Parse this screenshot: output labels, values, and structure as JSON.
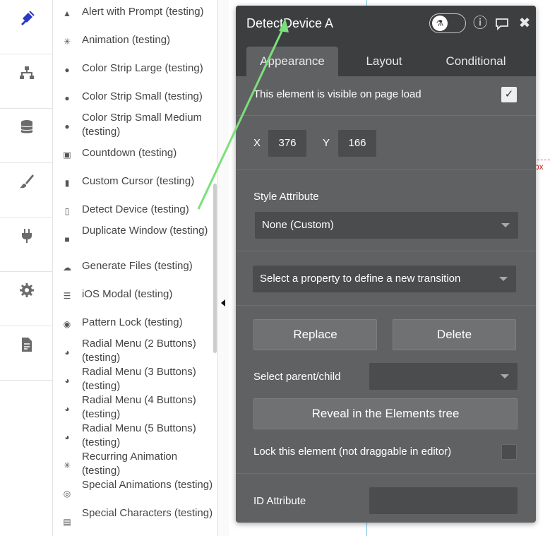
{
  "nav": [
    {
      "label": "Design",
      "icon": "design-icon",
      "active": true
    },
    {
      "label": "Workflow",
      "icon": "workflow-icon"
    },
    {
      "label": "Data",
      "icon": "database-icon"
    },
    {
      "label": "Styles",
      "icon": "brush-icon"
    },
    {
      "label": "Plugins",
      "icon": "plug-icon"
    },
    {
      "label": "Settings",
      "icon": "gear-icon"
    },
    {
      "label": "Logs",
      "icon": "document-icon"
    }
  ],
  "elements": [
    {
      "label": "Alert with Prompt (testing)",
      "icon": "warning-icon"
    },
    {
      "label": "Animation (testing)",
      "icon": "sparkle-icon"
    },
    {
      "label": "Color Strip Large (testing)",
      "icon": "palette-icon"
    },
    {
      "label": "Color Strip Small (testing)",
      "icon": "palette-icon"
    },
    {
      "label": "Color Strip Small Medium (testing)",
      "icon": "palette-icon"
    },
    {
      "label": "Countdown (testing)",
      "icon": "calendar-icon"
    },
    {
      "label": "Custom Cursor (testing)",
      "icon": "mouse-icon"
    },
    {
      "label": "Detect Device (testing)",
      "icon": "mobile-icon"
    },
    {
      "label": "Duplicate Window (testing)",
      "icon": "file-icon"
    },
    {
      "label": "Generate Files (testing)",
      "icon": "cloud-icon"
    },
    {
      "label": "iOS Modal (testing)",
      "icon": "list-icon"
    },
    {
      "label": "Pattern Lock (testing)",
      "icon": "lock-icon"
    },
    {
      "label": "Radial Menu (2 Buttons) (testing)",
      "icon": "pie-icon"
    },
    {
      "label": "Radial Menu (3 Buttons) (testing)",
      "icon": "pie-icon"
    },
    {
      "label": "Radial Menu (4 Buttons) (testing)",
      "icon": "pie-icon"
    },
    {
      "label": "Radial Menu (5 Buttons) (testing)",
      "icon": "pie-icon"
    },
    {
      "label": "Recurring Animation (testing)",
      "icon": "sparkle-icon"
    },
    {
      "label": "Special Animations (testing)",
      "icon": "target-icon"
    },
    {
      "label": "Special Characters (testing)",
      "icon": "document-icon"
    }
  ],
  "panel": {
    "title": "DetectDevice A",
    "tabs": [
      "Appearance",
      "Layout",
      "Conditional"
    ],
    "visible_label": "This element is visible on page load",
    "visible_checked": true,
    "x_label": "X",
    "x_value": "376",
    "y_label": "Y",
    "y_value": "166",
    "style_label": "Style Attribute",
    "style_value": "None (Custom)",
    "transition_value": "Select a property to define a new transition",
    "replace_label": "Replace",
    "delete_label": "Delete",
    "parent_child_label": "Select parent/child",
    "parent_child_value": "",
    "reveal_label": "Reveal in the Elements tree",
    "lock_label": "Lock this element (not draggable in editor)",
    "lock_checked": false,
    "id_label": "ID Attribute",
    "id_value": ""
  },
  "canvas": {
    "px_label": "px"
  },
  "colors": {
    "accent": "#2a39c8",
    "panel": "#5f6163",
    "panel_header": "#3c3e40",
    "arrow": "#7be07b"
  }
}
